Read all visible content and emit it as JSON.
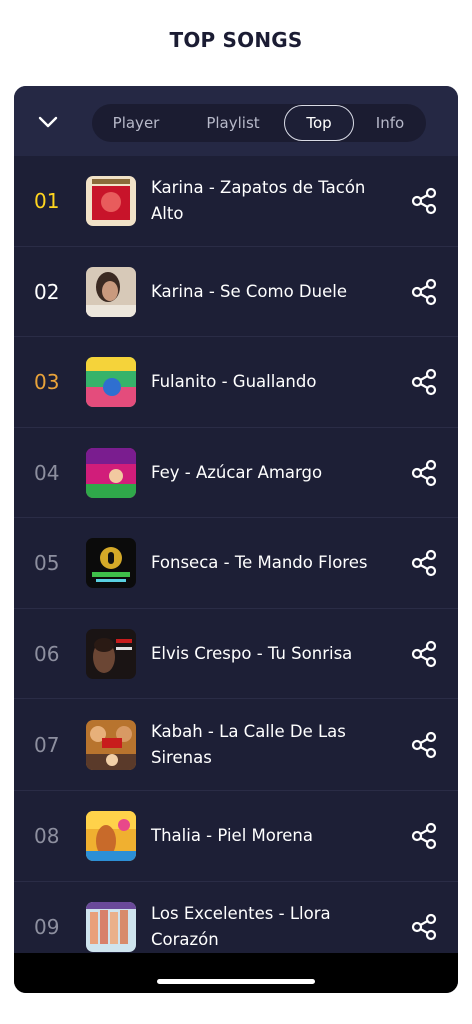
{
  "page": {
    "title": "TOP SONGS"
  },
  "header": {
    "collapse_icon": "chevron-down-icon",
    "tabs": [
      {
        "label": "Player",
        "active": false
      },
      {
        "label": "Playlist",
        "active": false
      },
      {
        "label": "Top",
        "active": true
      },
      {
        "label": "Info",
        "active": false
      }
    ]
  },
  "colors": {
    "gold": "#ffd51f",
    "white": "#ffffff",
    "bronze": "#e9a33a",
    "grey": "#8d8f9f",
    "card_bg": "#1d1f36"
  },
  "songs": [
    {
      "rank": "01",
      "title": "Karina - Zapatos de Tacón Alto",
      "rank_color": "#ffd51f",
      "share_icon": "share-icon"
    },
    {
      "rank": "02",
      "title": "Karina - Se Como Duele",
      "rank_color": "#ffffff",
      "share_icon": "share-icon"
    },
    {
      "rank": "03",
      "title": "Fulanito - Guallando",
      "rank_color": "#e9a33a",
      "share_icon": "share-icon"
    },
    {
      "rank": "04",
      "title": "Fey - Azúcar Amargo",
      "rank_color": "#8d8f9f",
      "share_icon": "share-icon"
    },
    {
      "rank": "05",
      "title": "Fonseca - Te Mando Flores",
      "rank_color": "#8d8f9f",
      "share_icon": "share-icon"
    },
    {
      "rank": "06",
      "title": "Elvis Crespo - Tu Sonrisa",
      "rank_color": "#8d8f9f",
      "share_icon": "share-icon"
    },
    {
      "rank": "07",
      "title": "Kabah - La Calle De Las Sirenas",
      "rank_color": "#8d8f9f",
      "share_icon": "share-icon"
    },
    {
      "rank": "08",
      "title": "Thalia - Piel Morena",
      "rank_color": "#8d8f9f",
      "share_icon": "share-icon"
    },
    {
      "rank": "09",
      "title": "Los Excelentes - Llora Corazón",
      "rank_color": "#8d8f9f",
      "share_icon": "share-icon"
    }
  ]
}
